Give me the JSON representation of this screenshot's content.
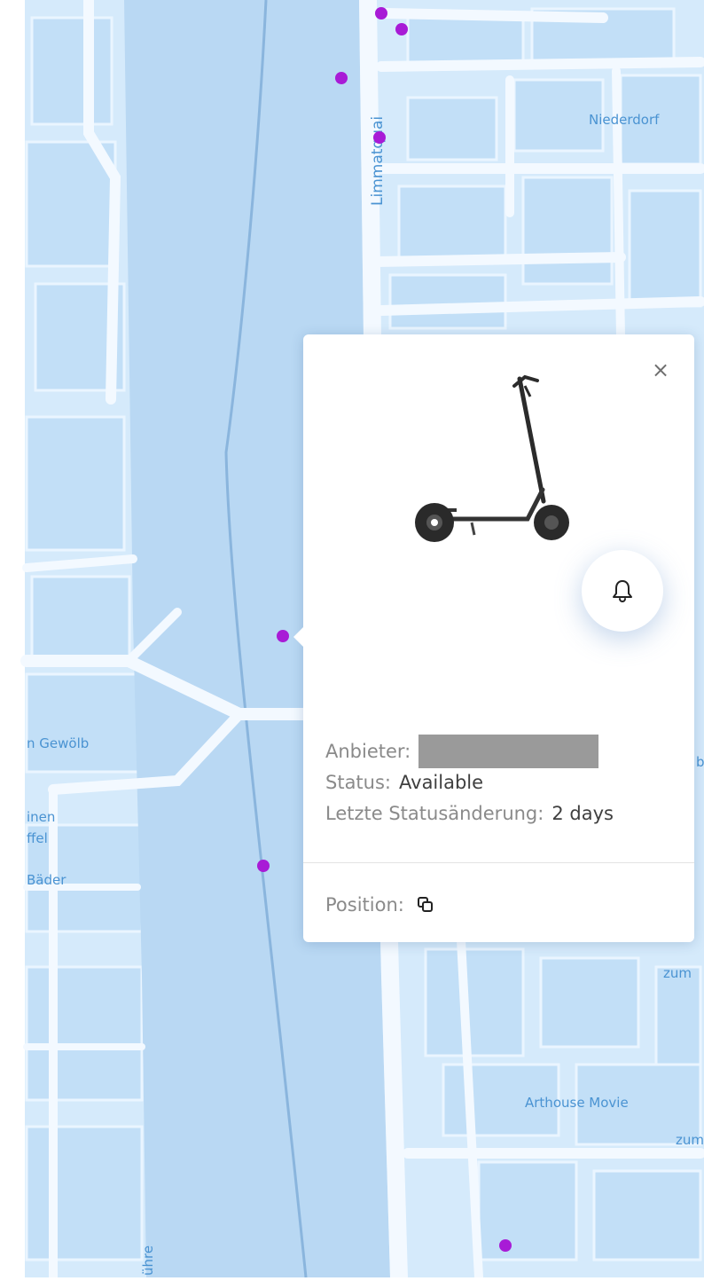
{
  "map": {
    "labels": {
      "limmatquai": "Limmatquai",
      "niederdorf": "Niederdorf",
      "gewolb": "n Gewölb",
      "inen": "inen",
      "ffel": "ffel",
      "bader": "Bäder",
      "zum1": "zum",
      "arthouse": "Arthouse Movie",
      "zum2": "zum",
      "fuhre": "ühre",
      "edge_right": "bl"
    },
    "colors": {
      "water": "#b9d8f3",
      "land": "#d5eafb",
      "building": "#c2dff7",
      "road": "#f3f9ff",
      "marker": "#a81bd6"
    }
  },
  "popup": {
    "close_label": "×",
    "icons": {
      "close": "close-icon",
      "bell": "bell-icon",
      "copy": "copy-icon",
      "vehicle": "scooter-icon"
    },
    "provider_label": "Anbieter:",
    "provider_value_redacted": true,
    "status_label": "Status:",
    "status_value": "Available",
    "last_change_label": "Letzte Statusänderung:",
    "last_change_value": "2 days",
    "position_label": "Position:"
  }
}
